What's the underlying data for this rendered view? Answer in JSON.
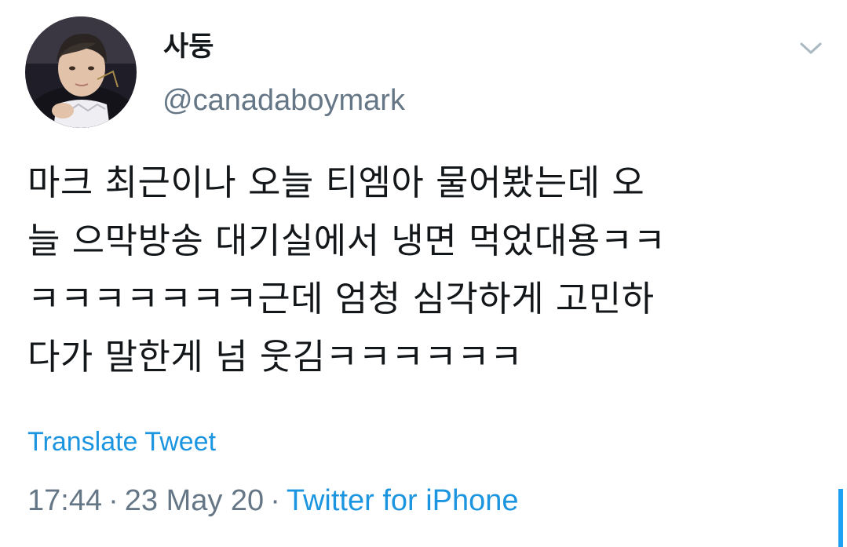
{
  "user": {
    "display_name": "사둥",
    "handle": "@canadaboymark"
  },
  "tweet": {
    "lines": [
      "마크 최근이나 오늘 티엠아 물어봤는데 오",
      "늘 으막방송 대기실에서 냉면 먹었대용ㅋㅋ",
      "ㅋㅋㅋㅋㅋㅋㅋ근데 엄청 심각하게 고민하",
      "다가 말한게 넘 웃김ㅋㅋㅋㅋㅋㅋ"
    ],
    "translate_label": "Translate Tweet"
  },
  "meta": {
    "time": "17:44",
    "separator": "·",
    "date": "23 May 20",
    "source": "Twitter for iPhone"
  },
  "icons": {
    "caret": "chevron-down-icon",
    "avatar": "avatar"
  },
  "colors": {
    "link": "#1b95e0",
    "secondary_text": "#657786",
    "primary_text": "#14171a",
    "accent": "#1da1f2"
  }
}
